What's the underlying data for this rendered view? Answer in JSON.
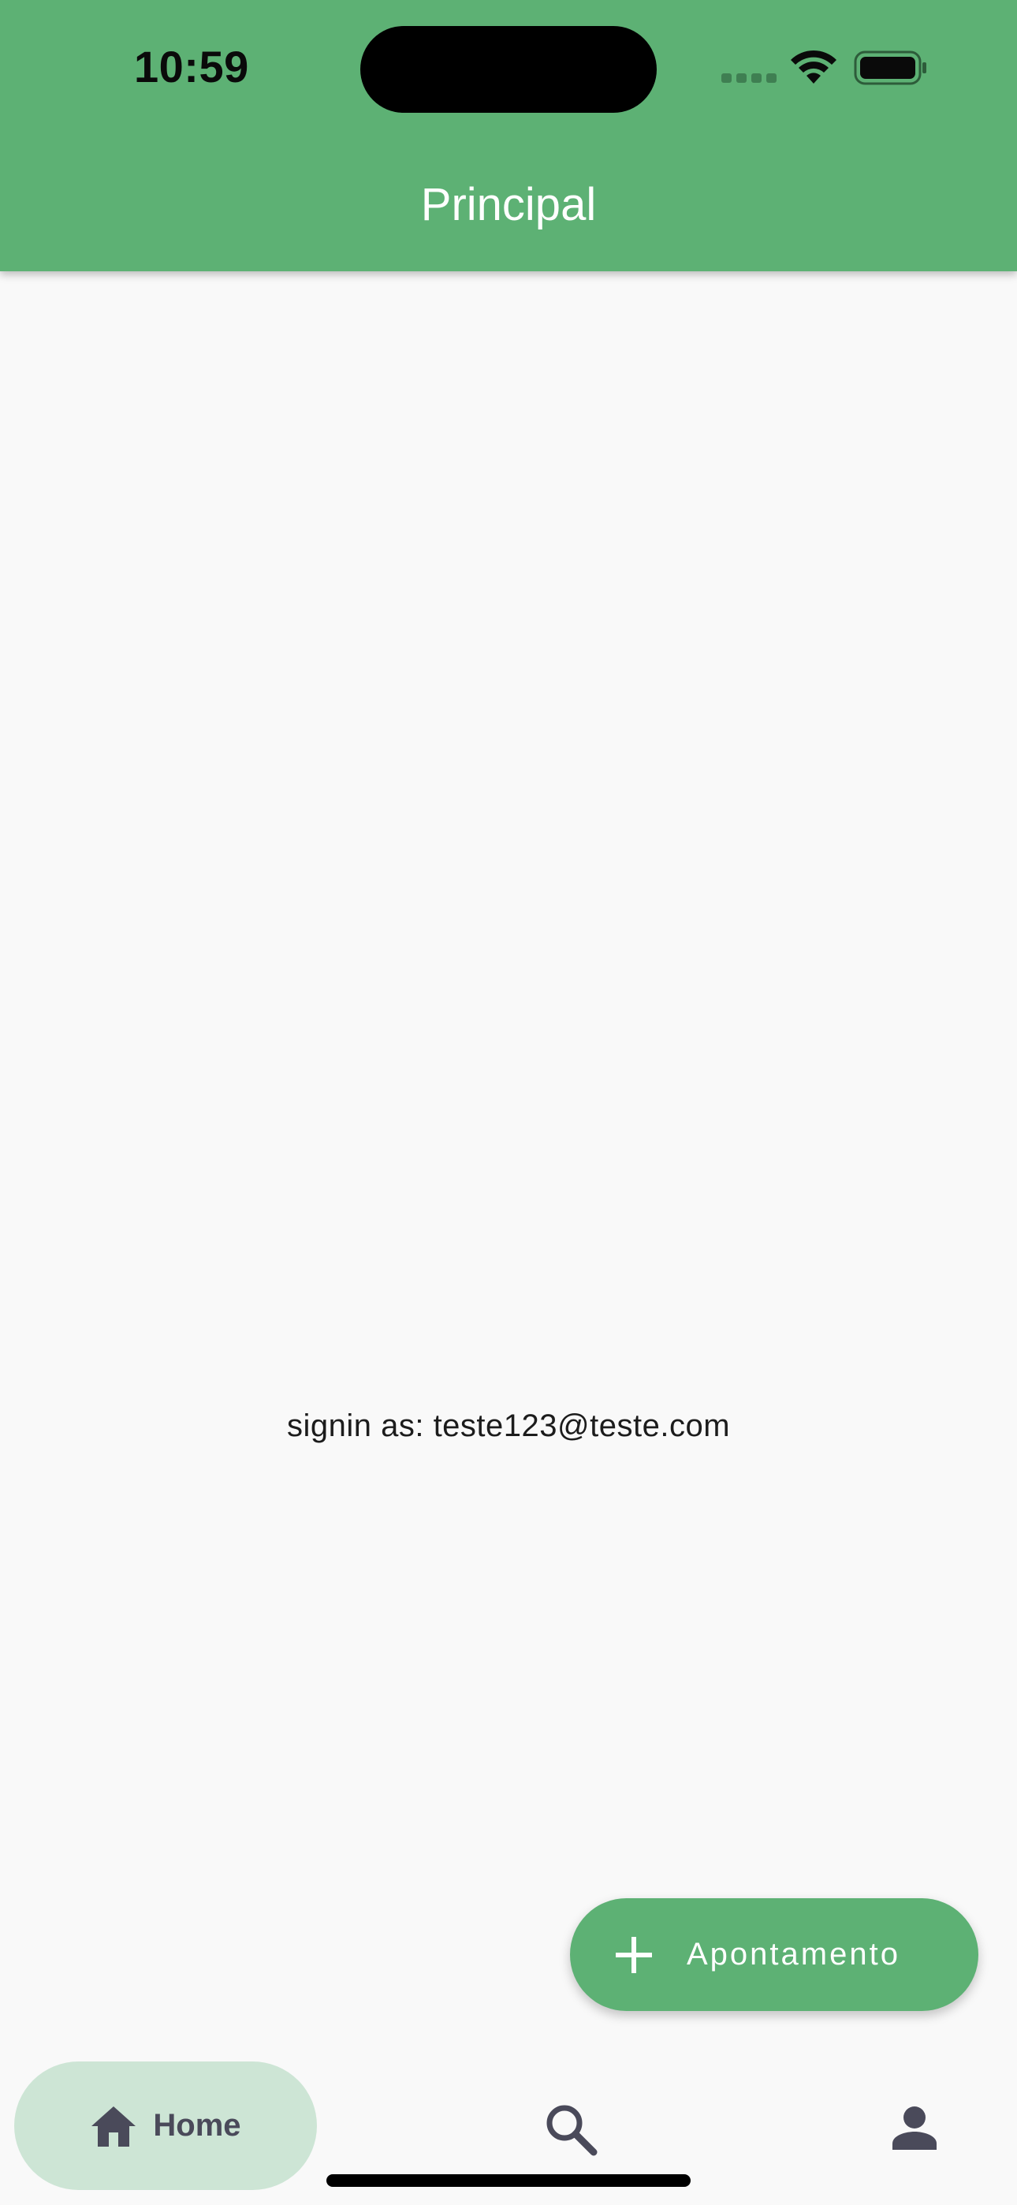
{
  "status_bar": {
    "time": "10:59"
  },
  "app_bar": {
    "title": "Principal",
    "color": "#5db174"
  },
  "main": {
    "signin_text": "signin as: teste123@teste.com"
  },
  "fab": {
    "icon": "plus-icon",
    "label": "Apontamento"
  },
  "bottom_nav": {
    "items": [
      {
        "icon": "home-icon",
        "label": "Home",
        "selected": true
      },
      {
        "icon": "search-icon",
        "label": "",
        "selected": false
      },
      {
        "icon": "person-icon",
        "label": "",
        "selected": false
      }
    ]
  }
}
